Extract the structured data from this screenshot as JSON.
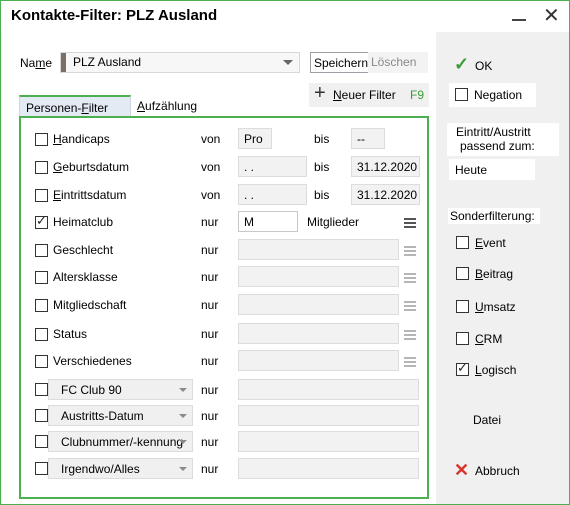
{
  "window": {
    "title": "Kontakte-Filter: PLZ Ausland"
  },
  "name_row": {
    "label_prefix": "Na",
    "label_underline": "m",
    "label_suffix": "e",
    "value": "PLZ Ausland",
    "save_label": "Speichern",
    "delete_label": "Löschen"
  },
  "new_filter": {
    "label_underline": "N",
    "label_rest": "euer Filter",
    "shortcut": "F9"
  },
  "tabs": [
    {
      "prefix": "Personen-",
      "underline": "F",
      "suffix": "ilter",
      "selected": true
    },
    {
      "prefix": "",
      "underline": "A",
      "suffix": "ufzählung",
      "selected": false
    }
  ],
  "rows": [
    {
      "u": "H",
      "rest": "andicaps",
      "checked": false,
      "mode": "von",
      "value1": "Pro",
      "to_label": "bis",
      "value2": "--"
    },
    {
      "u": "G",
      "rest": "eburtsdatum",
      "checked": false,
      "mode": "von",
      "value1": " .  .",
      "to_label": "bis",
      "value2": "31.12.2020"
    },
    {
      "u": "E",
      "rest": "intrittsdatum",
      "checked": false,
      "mode": "von",
      "value1": " .  .",
      "to_label": "bis",
      "value2": "31.12.2020"
    },
    {
      "u": "",
      "rest": "Heimatclub",
      "checked": true,
      "mode": "nur",
      "value1": "M",
      "suffix_label": "Mitglieder"
    },
    {
      "u": "",
      "rest": "Geschlecht",
      "checked": false,
      "mode": "nur",
      "value1": ""
    },
    {
      "u": "",
      "rest": "Altersklasse",
      "checked": false,
      "mode": "nur",
      "value1": ""
    },
    {
      "u": "",
      "rest": "Mitgliedschaft",
      "checked": false,
      "mode": "nur",
      "value1": ""
    },
    {
      "u": "",
      "rest": "Status",
      "checked": false,
      "mode": "nur",
      "value1": ""
    },
    {
      "u": "",
      "rest": "Verschiedenes",
      "checked": false,
      "mode": "nur",
      "value1": ""
    }
  ],
  "combo_rows": [
    {
      "value": "FC Club 90",
      "mode": "nur"
    },
    {
      "value": "Austritts-Datum",
      "mode": "nur"
    },
    {
      "value": "Clubnummer/-kennung",
      "mode": "nur"
    },
    {
      "value": "Irgendwo/Alles",
      "mode": "nur"
    }
  ],
  "right": {
    "ok_label": "OK",
    "negation_label": "Negation",
    "eintritt_line1": "Eintritt/Austritt",
    "eintritt_line2": "passend zum:",
    "eintritt_value": "Heute",
    "sonder_label": "Sonderfilterung:",
    "options": [
      {
        "label": "Event",
        "checked": false
      },
      {
        "label": "Beitrag",
        "checked": false
      },
      {
        "label": "Umsatz",
        "checked": false
      },
      {
        "label": "CRM",
        "checked": false
      },
      {
        "label": "Logisch",
        "checked": true
      }
    ],
    "datei_label": "Datei",
    "abbruch_label": "Abbruch"
  },
  "colors": {
    "accent_green": "#4caf50",
    "ok_check": "#3a9b3a",
    "cancel_red": "#d9342b"
  },
  "icons": {
    "ok": "checkmark-icon",
    "cancel": "x-icon",
    "new": "plus-icon",
    "list": "menu-icon"
  }
}
